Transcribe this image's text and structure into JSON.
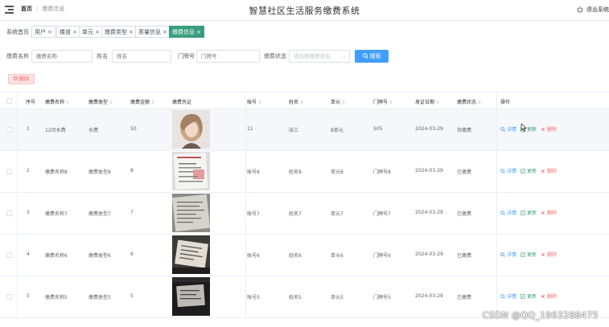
{
  "header": {
    "breadcrumb_home": "首页",
    "breadcrumb_sep": "/",
    "breadcrumb_current": "缴费信息",
    "title": "智慧社区生活服务缴费系统",
    "logout": "退出系统",
    "icons": {
      "menu": "menu-toggle-icon",
      "logout": "power-icon"
    }
  },
  "tags": [
    {
      "label": "系统首页",
      "closable": false,
      "active": false
    },
    {
      "label": "用户",
      "closable": true,
      "active": false
    },
    {
      "label": "楼道",
      "closable": true,
      "active": false
    },
    {
      "label": "单元",
      "closable": true,
      "active": false
    },
    {
      "label": "缴费类型",
      "closable": true,
      "active": false
    },
    {
      "label": "质量信息",
      "closable": true,
      "active": false
    },
    {
      "label": "缴费信息",
      "closable": true,
      "active": true
    }
  ],
  "tag_close": "×",
  "search": {
    "fee_name_label": "缴费名称",
    "fee_name_placeholder": "缴费名称",
    "name_label": "姓名",
    "name_placeholder": "姓名",
    "door_label": "门牌号",
    "door_placeholder": "门牌号",
    "status_label": "缴费状态",
    "status_placeholder": "请选择缴费状态",
    "search_button": "搜索"
  },
  "delete_button": "删除",
  "table": {
    "columns": [
      "序号",
      "缴费名称",
      "缴费类型",
      "缴费金额",
      "缴费凭证",
      "账号",
      "姓名",
      "单元",
      "门牌号",
      "发证日期",
      "缴费状态",
      "操作"
    ],
    "sort_icon": "⇅",
    "actions": {
      "detail": "详情",
      "edit": "更新",
      "delete": "删除"
    },
    "rows": [
      {
        "index": "1",
        "fee_name": "12月水费",
        "fee_type": "水费",
        "amount": "50",
        "account": "11",
        "name": "张三",
        "unit": "8单元",
        "door": "505",
        "date": "2024-03-29",
        "status": "待缴费",
        "photo": "portrait"
      },
      {
        "index": "2",
        "fee_name": "缴费名称8",
        "fee_type": "缴费类型8",
        "amount": "8",
        "account": "账号8",
        "name": "姓名8",
        "unit": "单元8",
        "door": "门牌号8",
        "date": "2024-03-29",
        "status": "已缴费",
        "photo": "document"
      },
      {
        "index": "3",
        "fee_name": "缴费名称7",
        "fee_type": "缴费类型7",
        "amount": "7",
        "account": "账号7",
        "name": "姓名7",
        "unit": "单元7",
        "door": "门牌号7",
        "date": "2024-03-29",
        "status": "已缴费",
        "photo": "paper"
      },
      {
        "index": "4",
        "fee_name": "缴费名称6",
        "fee_type": "缴费类型6",
        "amount": "6",
        "account": "账号6",
        "name": "姓名6",
        "unit": "单元6",
        "door": "门牌号6",
        "date": "2024-03-29",
        "status": "已缴费",
        "photo": "card"
      },
      {
        "index": "5",
        "fee_name": "缴费名称5",
        "fee_type": "缴费类型5",
        "amount": "5",
        "account": "账号5",
        "name": "姓名5",
        "unit": "单元5",
        "door": "门牌号5",
        "date": "2024-03-29",
        "status": "已缴费",
        "photo": "dark"
      }
    ]
  },
  "watermark": "CSDN @QQ_1963288475",
  "colors": {
    "primary": "#409eff",
    "accent": "#3a9e7e",
    "danger": "#f56c6c"
  }
}
